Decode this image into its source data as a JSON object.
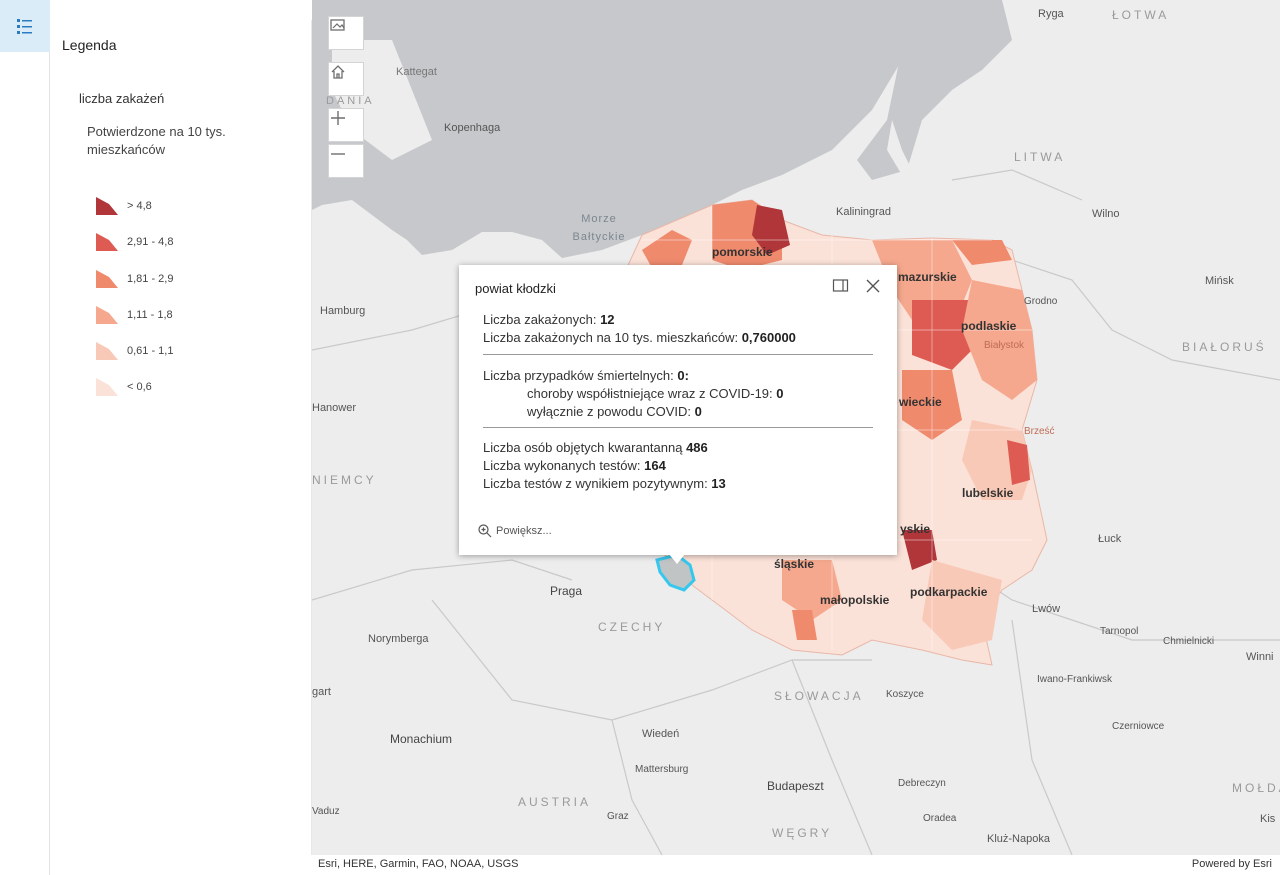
{
  "colors": {
    "water": "#c6c8cb",
    "land": "#ededed",
    "class1": "#b0363a",
    "class2": "#dd5b52",
    "class3": "#ef8a6d",
    "class4": "#f5a88e",
    "class5": "#f9c9b7",
    "class6": "#fbe2d8",
    "highlight": "#35c8ee"
  },
  "legend": {
    "title": "Legenda",
    "layer_title": "liczba zakażeń",
    "field_title": "Potwierdzone na 10 tys. mieszkańców",
    "classes": [
      {
        "label": "> 4,8",
        "color": "#b0363a"
      },
      {
        "label": "2,91 - 4,8",
        "color": "#dd5b52"
      },
      {
        "label": "1,81 - 2,9",
        "color": "#ef8a6d"
      },
      {
        "label": "1,11 - 1,8",
        "color": "#f5a88e"
      },
      {
        "label": "0,61 - 1,1",
        "color": "#f9c9b7"
      },
      {
        "label": "< 0,6",
        "color": "#fbe2d8"
      }
    ]
  },
  "map": {
    "labels": {
      "ryga": "Ryga",
      "lotwa": "ŁOTWA",
      "kattegat": "Kattegat",
      "dania": "DANIA",
      "kopenhaga": "Kopenhaga",
      "litwa": "LITWA",
      "morze_baltyckie": "Morze Bałtyckie",
      "kaliningrad": "Kaliningrad",
      "wilno": "Wilno",
      "mińsk": "Mińsk",
      "bialorus": "BIAŁORUŚ",
      "hamburg": "Hamburg",
      "grodno": "Grodno",
      "podlaskie": "podlaskie",
      "bialystok": "Białystok",
      "hanower": "Hanower",
      "niemcy": "NIEMCY",
      "brzesc": "Brześć",
      "lubelskie": "lubelskie",
      "luck": "Łuck",
      "praga": "Praga",
      "czechy": "CZECHY",
      "slaskie": "śląskie",
      "malopolskie": "małopolskie",
      "podkarpackie": "podkarpackie",
      "lwow": "Lwów",
      "norymberga": "Norymberga",
      "tarnopol": "Tarnopol",
      "chmielnicki": "Chmielnicki",
      "winnica": "Winni",
      "iwano": "Iwano-Frankiwsk",
      "stuttgart": "gart",
      "slowacja": "SŁOWACJA",
      "koszyce": "Koszyce",
      "monachium": "Monachium",
      "wieden": "Wiedeń",
      "mattersburg": "Mattersburg",
      "czerniowce": "Czerniowce",
      "budapeszt": "Budapeszt",
      "debreczyn": "Debreczyn",
      "austria": "AUSTRIA",
      "graz": "Graz",
      "wegry": "WĘGRY",
      "oradea": "Oradea",
      "kluz": "Kluż-Napoka",
      "moldawia": "MOŁDA",
      "kis": "Kis",
      "zadar": "Vaduz",
      "pomorskie": "pomorskie",
      "mazurskie": "mazurskie",
      "wieckie": "wieckie",
      "yskie": "yskie"
    }
  },
  "popup": {
    "title": "powiat kłodzki",
    "line1_label": "Liczba zakażonych: ",
    "line1_value": "12",
    "line2_label": "Liczba zakażonych na 10 tys. mieszkańców: ",
    "line2_value": "0,760000",
    "line3_label": "Liczba przypadków śmiertelnych: ",
    "line3_value": "0:",
    "line4_label": "choroby współistniejące wraz z COVID-19: ",
    "line4_value": "0",
    "line5_label": "wyłącznie z powodu COVID: ",
    "line5_value": "0",
    "line6_label": "Liczba osób objętych kwarantanną ",
    "line6_value": "486",
    "line7_label": "Liczba wykonanych testów: ",
    "line7_value": "164",
    "line8_label": "Liczba testów z wynikiem pozytywnym: ",
    "line8_value": "13",
    "zoom_label": "Powiększ..."
  },
  "attribution": {
    "text": "Esri, HERE, Garmin, FAO, NOAA, USGS",
    "powered": "Powered by Esri"
  }
}
